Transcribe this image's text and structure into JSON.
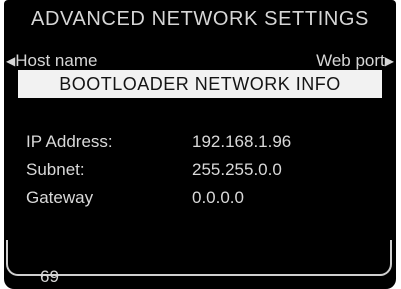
{
  "screen": {
    "title": "ADVANCED NETWORK SETTINGS",
    "nav_left": {
      "arrow": "◀",
      "label": "Host name"
    },
    "nav_right": {
      "label": "Web port",
      "arrow": "▶"
    },
    "banner": "BOOTLOADER NETWORK INFO",
    "info_rows": [
      {
        "label": "IP Address:",
        "value": "192.168.1.96"
      },
      {
        "label": "Subnet:",
        "value": "255.255.0.0"
      },
      {
        "label": "Gateway",
        "value": "0.0.0.0"
      }
    ],
    "page_number": "69"
  }
}
